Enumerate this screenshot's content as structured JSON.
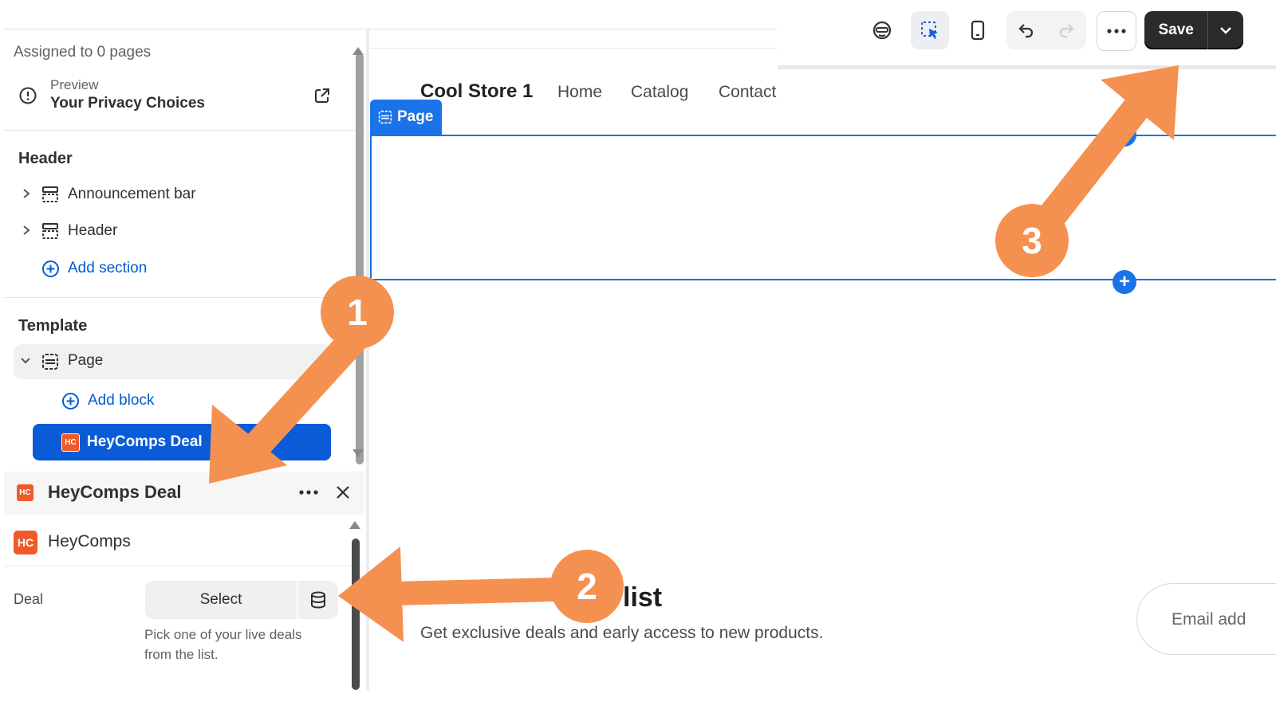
{
  "toolbar": {
    "save_label": "Save",
    "icons": [
      "inspector-icon",
      "select-element-icon",
      "mobile-preview-icon",
      "undo-icon",
      "redo-icon",
      "more-icon",
      "chevron-down-icon"
    ]
  },
  "sidebar": {
    "assigned": "Assigned to 0 pages",
    "preview_label": "Preview",
    "preview_title": "Your Privacy Choices",
    "header_section": {
      "title": "Header",
      "items": [
        {
          "label": "Announcement bar"
        },
        {
          "label": "Header"
        }
      ],
      "add_label": "Add section"
    },
    "template_section": {
      "title": "Template",
      "page_label": "Page",
      "add_block_label": "Add block",
      "selected_block": "HeyComps Deal",
      "block_logo": "HC"
    }
  },
  "block_panel": {
    "title": "HeyComps Deal",
    "app_name": "HeyComps",
    "app_logo": "HC",
    "deal_label": "Deal",
    "select_label": "Select",
    "help_line1": "Pick one of your live deals",
    "help_line2": "from the list."
  },
  "preview": {
    "store_name": "Cool Store 1",
    "nav": [
      "Home",
      "Catalog",
      "Contact"
    ],
    "page_tag": "Page",
    "newsletter_title": "list",
    "newsletter_sub": "Get exclusive deals and early access to new products.",
    "email_placeholder": "Email add"
  },
  "annotations": {
    "badges": [
      "1",
      "2",
      "3"
    ],
    "color": "#f59150"
  },
  "colors": {
    "accent": "#1a73e8",
    "selected": "#0a5bd8",
    "save_bg": "#2b2b2b",
    "brand": "#f05a28"
  }
}
